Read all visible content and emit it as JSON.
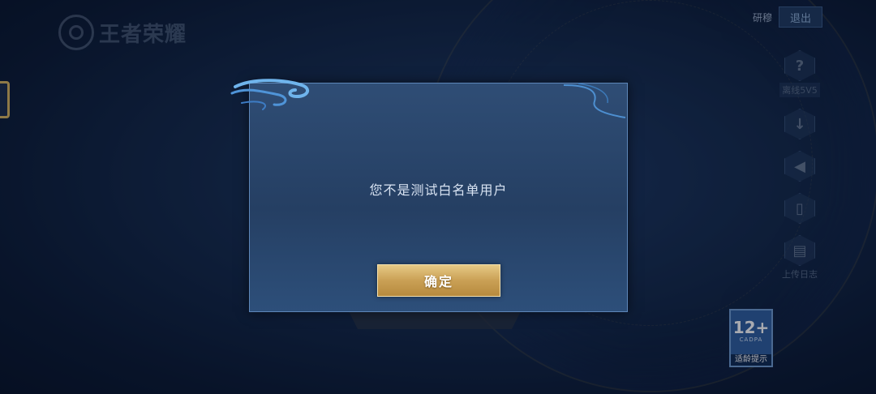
{
  "header": {
    "logo_text": "王者荣耀",
    "language_label": "研穆",
    "exit_label": "退出"
  },
  "side_menu": [
    {
      "icon": "question-icon",
      "glyph": "?",
      "label": "离线5V5"
    },
    {
      "icon": "download-icon",
      "glyph": "↓",
      "label": ""
    },
    {
      "icon": "speaker-icon",
      "glyph": "◀",
      "label": ""
    },
    {
      "icon": "phone-icon",
      "glyph": "▯",
      "label": ""
    },
    {
      "icon": "clipboard-icon",
      "glyph": "▤",
      "label": "上传日志"
    }
  ],
  "dialog": {
    "message": "您不是测试白名单用户",
    "confirm_label": "确定"
  },
  "age_rating": {
    "age": "12+",
    "org": "CADPA",
    "tip": "适龄提示"
  },
  "colors": {
    "dialog_border": "#5d86b8",
    "confirm_gold": "#caa055",
    "badge_blue": "#2e5f9e"
  }
}
